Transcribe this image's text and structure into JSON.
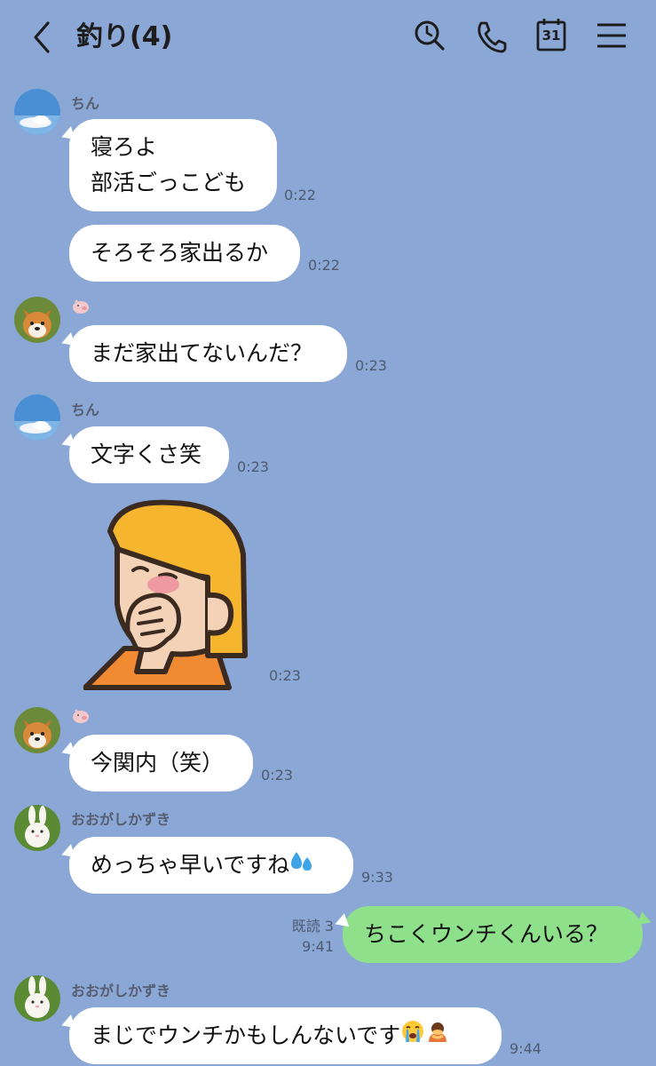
{
  "header": {
    "title": "釣り(4)",
    "icons": [
      "back-chevron-icon",
      "search-icon",
      "phone-icon",
      "calendar-icon",
      "menu-icon"
    ],
    "calendar_day": "31"
  },
  "colors": {
    "background": "#8ba7d6",
    "incoming_bubble": "#ffffff",
    "outgoing_bubble": "#8fe08a"
  },
  "messages": [
    {
      "sender": "ちん",
      "text": "寝ろよ\n部活ごっこども",
      "time": "0:22"
    },
    {
      "text": "そろそろ家出るか",
      "time": "0:22"
    },
    {
      "sender_icon": "pig-icon",
      "text": "まだ家出てないんだ？",
      "time": "0:23"
    },
    {
      "sender": "ちん",
      "text": "文字くさ笑",
      "time": "0:23"
    },
    {
      "sticker": "blushing-person-sticker",
      "time": "0:23"
    },
    {
      "sender_icon": "pig-icon",
      "text": "今関内（笑）",
      "time": "0:23"
    },
    {
      "sender": "おおがしかずき",
      "text": "めっちゃ早いですね",
      "emoji": "sweat-droplets-icon",
      "time": "9:33"
    },
    {
      "outgoing": true,
      "read": "既読 3",
      "text": "ちこくウンチくんいる？",
      "time": "9:41"
    },
    {
      "sender": "おおがしかずき",
      "text": "まじでウンチかもしんないです",
      "emoji": [
        "loudly-crying-face-icon",
        "person-bowing-icon"
      ],
      "time": "9:44"
    }
  ]
}
